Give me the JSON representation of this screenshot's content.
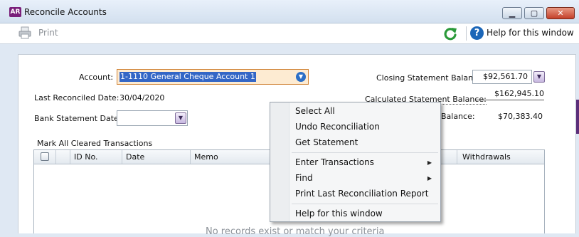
{
  "window": {
    "app_badge": "AR",
    "title": "Reconcile Accounts",
    "min_glyph": "▁",
    "max_glyph": "▢",
    "close_glyph": "✕"
  },
  "toolbar": {
    "print_label": "Print",
    "help_label": "Help for this window",
    "help_glyph": "?"
  },
  "form": {
    "account_label": "Account:",
    "account_value": "1-1110 General Cheque Account 1",
    "last_reconciled_label": "Last Reconciled Date:",
    "last_reconciled_value": "30/04/2020",
    "bank_statement_date_label": "Bank Statement Date:",
    "bank_statement_date_value": "",
    "closing_balance_label": "Closing Statement Balance:",
    "closing_balance_value": "$92,561.70",
    "calculated_balance_label": "Calculated Statement Balance:",
    "calculated_balance_value": "$162,945.10",
    "out_of_balance_label_partial": "Balance:",
    "out_of_balance_value": "$70,383.40"
  },
  "table": {
    "caption": "Mark All Cleared Transactions",
    "columns": [
      "ID No.",
      "Date",
      "Memo",
      "Withdrawals"
    ],
    "empty_message": "No records exist or match your criteria"
  },
  "context_menu": {
    "items": [
      {
        "label": "Select All",
        "submenu": false
      },
      {
        "label": "Undo Reconciliation",
        "submenu": false
      },
      {
        "label": "Get Statement",
        "submenu": false
      },
      {
        "label": "Enter Transactions",
        "submenu": true
      },
      {
        "label": "Find",
        "submenu": true
      },
      {
        "label": "Print Last Reconciliation Report",
        "submenu": false
      },
      {
        "label": "Help for this window",
        "submenu": false
      }
    ]
  },
  "colors": {
    "accent": "#3366c6",
    "field_highlight": "#fdebd2",
    "app_badge": "#7a1f7a"
  },
  "icons": [
    "printer-icon",
    "refresh-icon",
    "help-icon",
    "dropdown-icon",
    "calendar-dropdown-icon"
  ]
}
